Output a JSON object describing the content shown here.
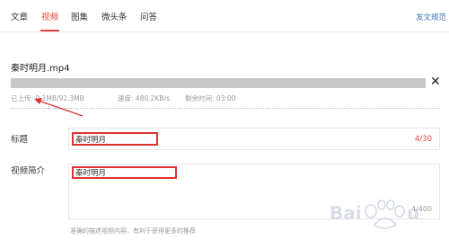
{
  "tabs": [
    {
      "label": "文章",
      "active": false
    },
    {
      "label": "视频",
      "active": true
    },
    {
      "label": "图集",
      "active": false
    },
    {
      "label": "微头条",
      "active": false
    },
    {
      "label": "问答",
      "active": false
    }
  ],
  "top_link": "发文规范",
  "upload": {
    "file_name": "秦时明月.mp4",
    "progress": 0.0,
    "uploaded_label": "已上传:",
    "uploaded_value": "0.1MB/92.3MB",
    "speed_label": "速度:",
    "speed_value": "480.2KB/s",
    "remaining_label": "剩余时间:",
    "remaining_value": "03:00",
    "cancel_symbol": "✕"
  },
  "title_field": {
    "label": "标题",
    "value": "秦时明月",
    "count": "4/30"
  },
  "desc_field": {
    "label": "视频简介",
    "value": "秦时明月",
    "count": "4/400",
    "hint": "准确的描述视频内容，有利于获得更多的推荐"
  },
  "watermark_text": "Baidu经验",
  "colors": {
    "accent": "#e9413d",
    "annotation": "#e03232",
    "link": "#3d6fb5",
    "progress_track": "#c8c8c8"
  }
}
